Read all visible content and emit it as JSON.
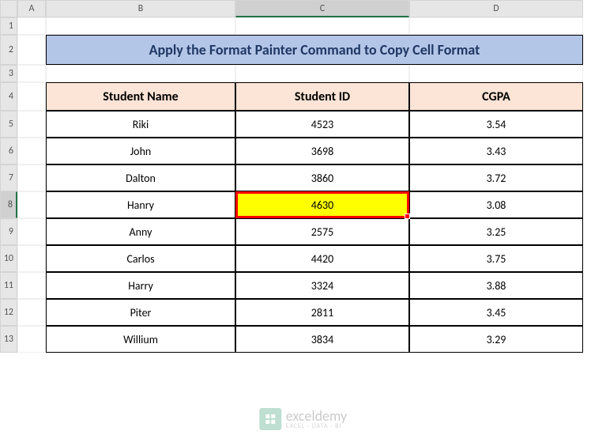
{
  "columns": [
    "",
    "A",
    "B",
    "C",
    "D"
  ],
  "rows": [
    "1",
    "2",
    "3",
    "4",
    "5",
    "6",
    "7",
    "8",
    "9",
    "10",
    "11",
    "12",
    "13"
  ],
  "activeColumn": "C",
  "activeRow": "8",
  "title": "Apply the Format Painter Command to Copy Cell Format",
  "headers": {
    "name": "Student Name",
    "id": "Student ID",
    "cgpa": "CGPA"
  },
  "students": [
    {
      "name": "Riki",
      "id": "4523",
      "cgpa": "3.54"
    },
    {
      "name": "John",
      "id": "3698",
      "cgpa": "3.43"
    },
    {
      "name": "Dalton",
      "id": "3860",
      "cgpa": "3.72"
    },
    {
      "name": "Hanry",
      "id": "4630",
      "cgpa": "3.08"
    },
    {
      "name": "Anny",
      "id": "2575",
      "cgpa": "3.25"
    },
    {
      "name": "Carlos",
      "id": "4420",
      "cgpa": "3.75"
    },
    {
      "name": "Harry",
      "id": "3324",
      "cgpa": "3.88"
    },
    {
      "name": "Piter",
      "id": "2811",
      "cgpa": "3.45"
    },
    {
      "name": "Willium",
      "id": "3834",
      "cgpa": "3.29"
    }
  ],
  "highlightedCell": {
    "row": 3,
    "col": "id"
  },
  "watermark": {
    "main": "exceldemy",
    "sub": "EXCEL · DATA · BI"
  },
  "chart_data": {
    "type": "table",
    "title": "Apply the Format Painter Command to Copy Cell Format",
    "columns": [
      "Student Name",
      "Student ID",
      "CGPA"
    ],
    "rows": [
      [
        "Riki",
        4523,
        3.54
      ],
      [
        "John",
        3698,
        3.43
      ],
      [
        "Dalton",
        3860,
        3.72
      ],
      [
        "Hanry",
        4630,
        3.08
      ],
      [
        "Anny",
        2575,
        3.25
      ],
      [
        "Carlos",
        4420,
        3.75
      ],
      [
        "Harry",
        3324,
        3.88
      ],
      [
        "Piter",
        2811,
        3.45
      ],
      [
        "Willium",
        3834,
        3.29
      ]
    ]
  }
}
